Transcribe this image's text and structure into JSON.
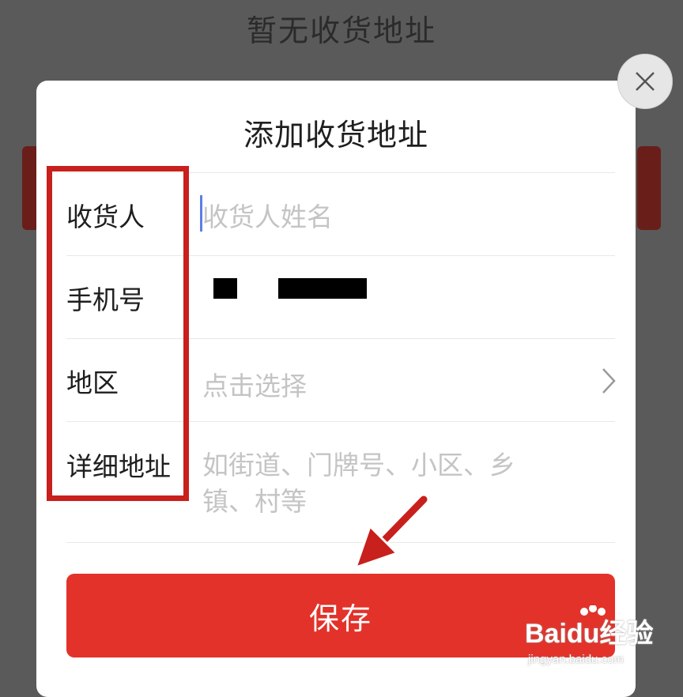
{
  "background": {
    "title": "暂无收货地址"
  },
  "dialog": {
    "title": "添加收货地址",
    "fields": [
      {
        "label": "收货人",
        "placeholder": "收货人姓名",
        "value": ""
      },
      {
        "label": "手机号",
        "placeholder": "",
        "value": "(redacted)"
      },
      {
        "label": "地区",
        "placeholder": "点击选择",
        "value": ""
      },
      {
        "label": "详细地址",
        "placeholder": "如街道、门牌号、小区、乡镇、村等",
        "value": ""
      }
    ],
    "detail_placeholder_line1": "如街道、门牌号、小区、乡",
    "detail_placeholder_line2": "镇、村等",
    "save_label": "保存"
  },
  "watermark": {
    "brand": "Baidu经验",
    "site": "jingyan.baidu.com"
  },
  "colors": {
    "accent": "#e2322a",
    "highlight_box": "#c8201c",
    "overlay": "#5a5a5a",
    "cursor": "#5b7fe6"
  },
  "icons": [
    "close-icon",
    "chevron-right-icon",
    "arrow-annotation-icon",
    "paw-logo-icon"
  ]
}
